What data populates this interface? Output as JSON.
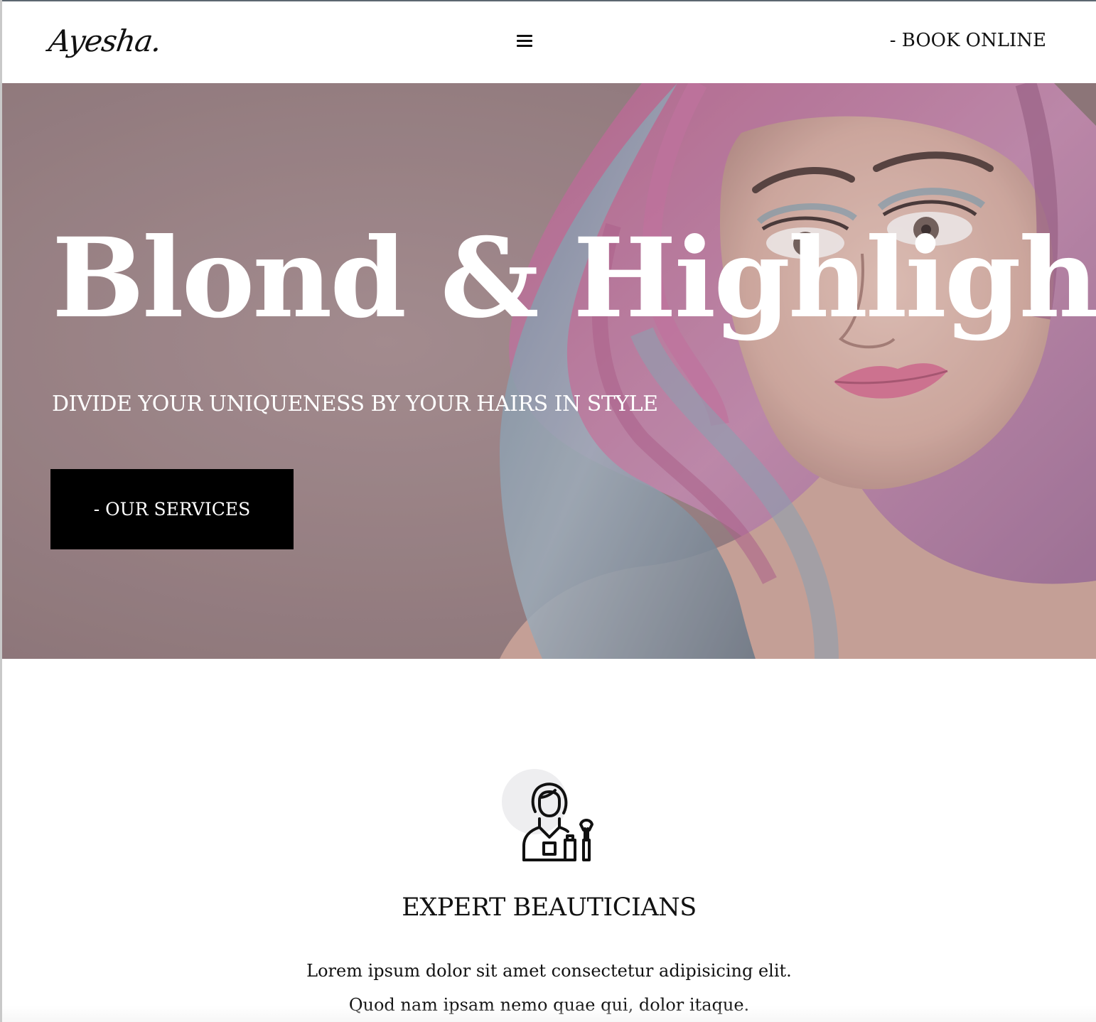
{
  "header": {
    "logo": "Ayesha.",
    "menu_icon": "hamburger-menu-icon",
    "book_label": "- BOOK ONLINE"
  },
  "hero": {
    "title": "Blond & Highlight",
    "subtitle": "DIVIDE YOUR UNIQUENESS BY YOUR HAIRS IN STYLE",
    "cta_label": "- OUR SERVICES"
  },
  "feature": {
    "icon": "beautician-icon",
    "title": "EXPERT BEAUTICIANS",
    "line1": "Lorem ipsum dolor sit amet consectetur adipisicing elit.",
    "line2": "Quod nam ipsam nemo quae qui, dolor itaque."
  },
  "colors": {
    "hero_tint": "#957c80",
    "button_bg": "#000000",
    "text": "#111111"
  }
}
